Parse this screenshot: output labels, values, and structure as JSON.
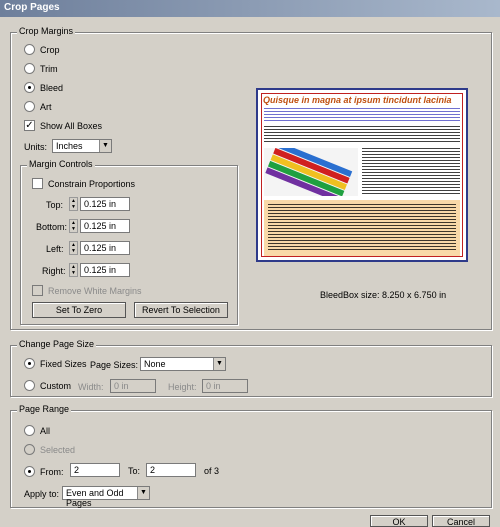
{
  "dialog": {
    "title": "Crop Pages"
  },
  "crop_margins": {
    "legend": "Crop Margins",
    "options": [
      "Crop",
      "Trim",
      "Bleed",
      "Art"
    ],
    "selected": "Bleed",
    "show_all_boxes": {
      "label": "Show All Boxes",
      "checked": true
    },
    "units": {
      "label": "Units:",
      "value": "Inches"
    }
  },
  "margin_controls": {
    "legend": "Margin Controls",
    "constrain": {
      "label": "Constrain Proportions",
      "checked": false
    },
    "top": {
      "label": "Top:",
      "value": "0.125 in"
    },
    "bottom": {
      "label": "Bottom:",
      "value": "0.125 in"
    },
    "left": {
      "label": "Left:",
      "value": "0.125 in"
    },
    "right": {
      "label": "Right:",
      "value": "0.125 in"
    },
    "remove_white": {
      "label": "Remove White Margins",
      "checked": false
    },
    "set_to_zero": "Set To Zero",
    "revert": "Revert To Selection"
  },
  "preview": {
    "heading": "Quisque in magna at ipsum tincidunt lacinia",
    "bleedbox_size": "BleedBox size: 8.250 x 6.750 in"
  },
  "change_page_size": {
    "legend": "Change Page Size",
    "fixed_sizes": "Fixed Sizes",
    "page_sizes_label": "Page Sizes:",
    "page_sizes_value": "None",
    "custom": "Custom",
    "width_label": "Width:",
    "width_value": "0 in",
    "height_label": "Height:",
    "height_value": "0 in"
  },
  "page_range": {
    "legend": "Page Range",
    "all": "All",
    "selected": "Selected",
    "from_label": "From:",
    "from_value": "2",
    "to_label": "To:",
    "to_value": "2",
    "of_text": "of 3",
    "apply_label": "Apply to:",
    "apply_value": "Even and Odd Pages"
  },
  "footer": {
    "ok": "OK",
    "cancel": "Cancel"
  },
  "colors": {
    "title_bar": "#6e7f9b",
    "dialog_bg": "#d4d0c8",
    "preview_border": "#2e3a8a"
  }
}
